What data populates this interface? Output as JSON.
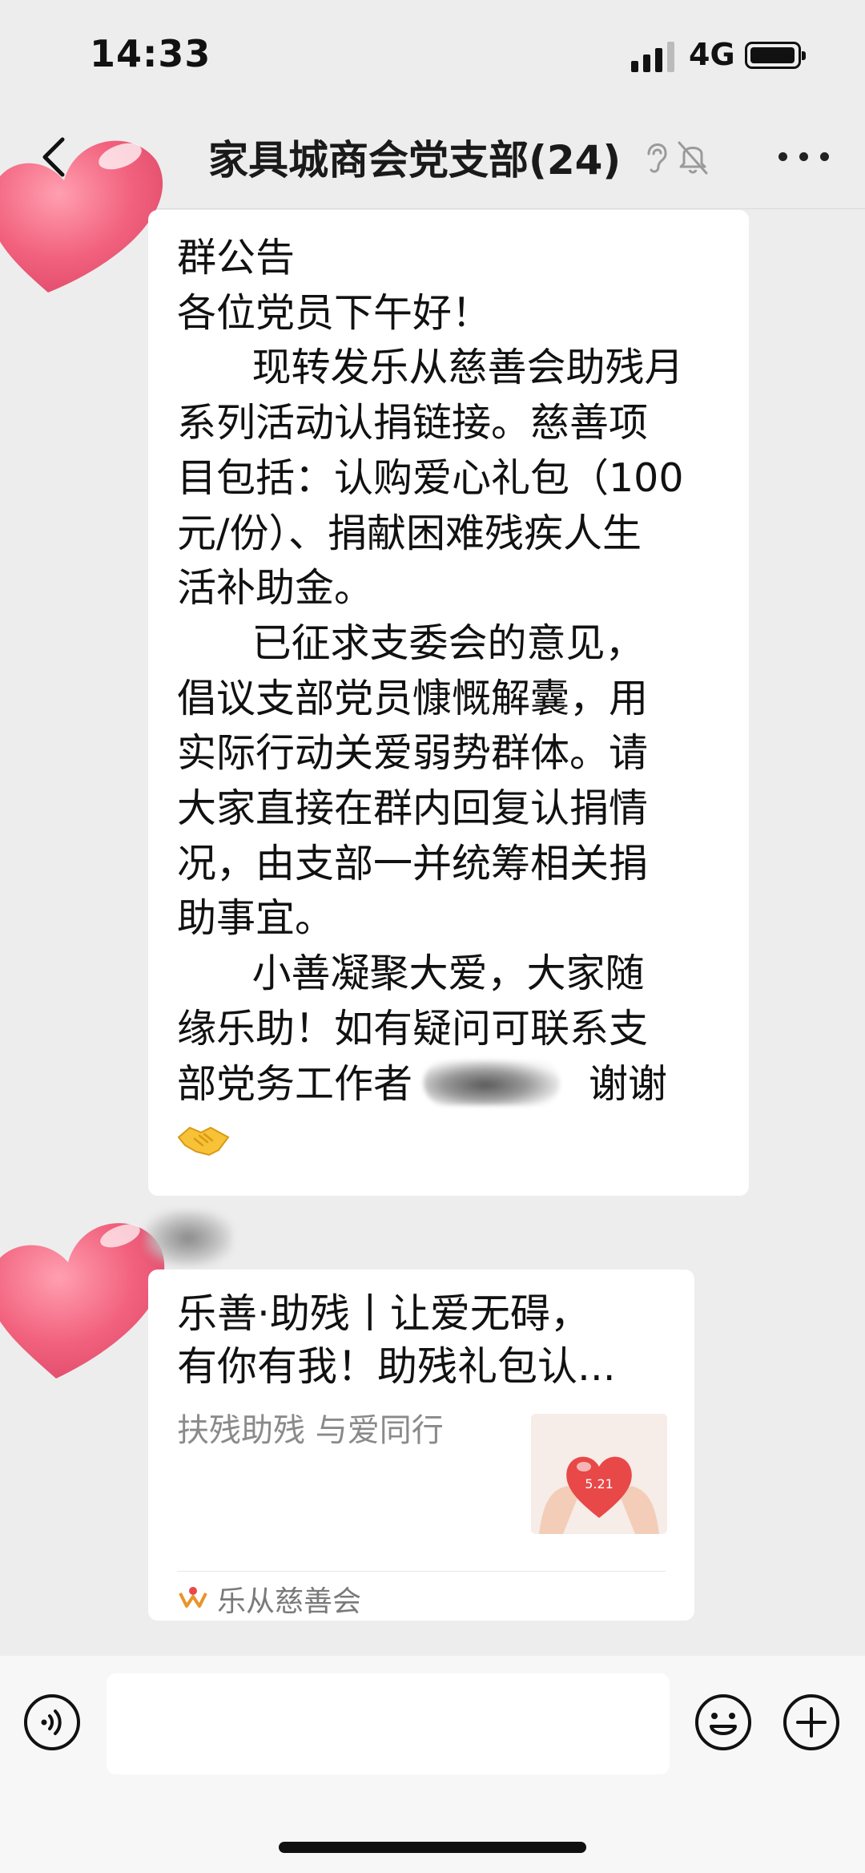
{
  "status_bar": {
    "time": "14:33",
    "network": "4G"
  },
  "chat": {
    "title": "家具城商会党支部(24)"
  },
  "notice": {
    "lines": [
      "群公告",
      "各位党员下午好！",
      "      现转发乐从慈善会助残月",
      "系列活动认捐链接。慈善项",
      "目包括：认购爱心礼包（100",
      "元/份）、捐献困难残疾人生",
      "活补助金。",
      "      已征求支委会的意见，",
      "倡议支部党员慷慨解囊，用",
      "实际行动关爱弱势群体。请",
      "大家直接在群内回复认捐情",
      "况，由支部一并统筹相关捐",
      "助事宜。",
      "      小善凝聚大爱，大家随",
      "缘乐助！如有疑问可联系支"
    ],
    "last_line_before": "部党务工作者",
    "last_line_after": "谢谢",
    "emoji": "handshake-icon"
  },
  "link_card": {
    "title_line1": "乐善·助残丨让爱无碍，",
    "title_line2": "有你有我！助残礼包认...",
    "description": "扶残助残 与爱同行",
    "thumbnail_text": "5.21",
    "source": "乐从慈善会"
  },
  "colors": {
    "background": "#ededed",
    "bubble": "#ffffff",
    "heart": "#f2627e",
    "input_bar": "#f7f7f7"
  }
}
